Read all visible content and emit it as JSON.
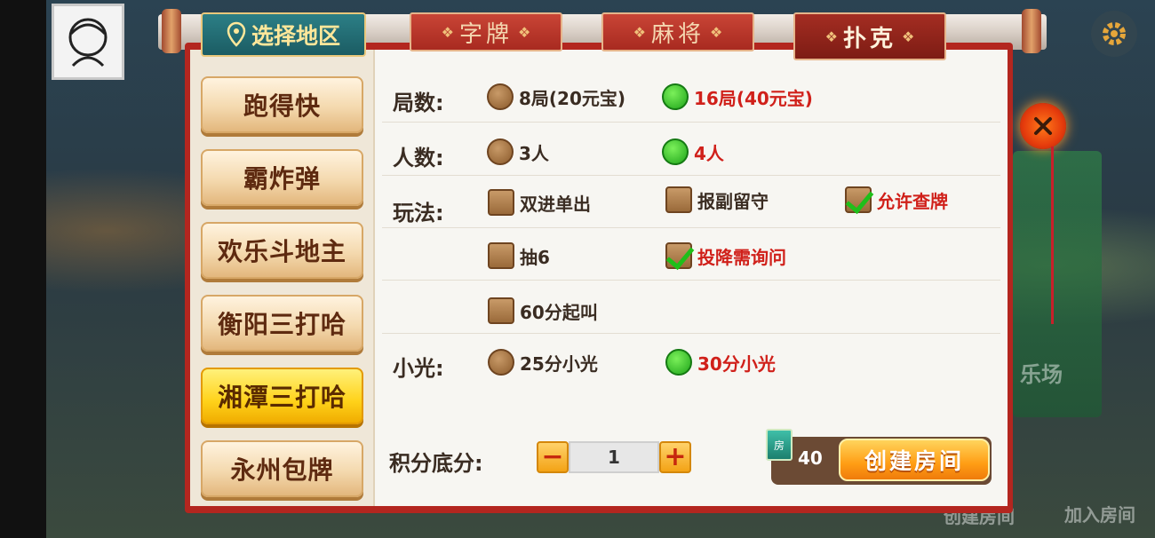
{
  "region_tab": {
    "label": "选择地区"
  },
  "category_tabs": [
    {
      "label": "字牌"
    },
    {
      "label": "麻将"
    },
    {
      "label": "扑克"
    }
  ],
  "games": [
    {
      "label": "跑得快"
    },
    {
      "label": "霸炸弹"
    },
    {
      "label": "欢乐斗地主"
    },
    {
      "label": "衡阳三打哈"
    },
    {
      "label": "湘潭三打哈"
    },
    {
      "label": "永州包牌"
    }
  ],
  "active_game": "湘潭三打哈",
  "options": {
    "rounds": {
      "label": "局数:",
      "choices": [
        {
          "label": "8局(20元宝)",
          "selected": false
        },
        {
          "label": "16局(40元宝)",
          "selected": true
        }
      ]
    },
    "players": {
      "label": "人数:",
      "choices": [
        {
          "label": "3人",
          "selected": false
        },
        {
          "label": "4人",
          "selected": true
        }
      ]
    },
    "rules": {
      "label": "玩法:",
      "choices": [
        {
          "label": "双进单出",
          "checked": false
        },
        {
          "label": "报副留守",
          "checked": false
        },
        {
          "label": "允许查牌",
          "checked": true
        },
        {
          "label": "抽6",
          "checked": false
        },
        {
          "label": "投降需询问",
          "checked": true
        },
        {
          "label": "60分起叫",
          "checked": false
        }
      ]
    },
    "xiaoguang": {
      "label": "小光:",
      "choices": [
        {
          "label": "25分小光",
          "selected": false
        },
        {
          "label": "30分小光",
          "selected": true
        }
      ]
    }
  },
  "base_score": {
    "label": "积分底分:",
    "value": "1",
    "minus": "−",
    "plus": "+"
  },
  "create": {
    "cost": "40",
    "card_glyph": "房",
    "button_label": "创建房间"
  },
  "background": {
    "happy_hall": "乐场",
    "create_room": "创建房间",
    "join_room": "加入房间"
  },
  "colors": {
    "selected_text": "#d0201a",
    "panel_border": "#b3261f",
    "active_game": "#ffd21a"
  }
}
